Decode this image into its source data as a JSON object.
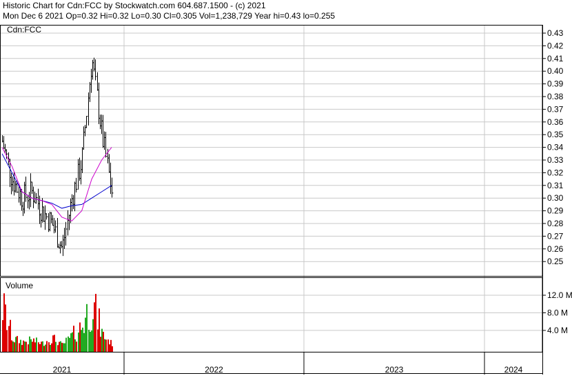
{
  "header": {
    "line1": "Historic Chart for Cdn:FCC by Stockwatch.com 604.687.1500 - (c) 2021",
    "line2": "Mon Dec  6 2021  Op=0.32  Hi=0.32  Lo=0.30  Cl=0.305  Vol=1,238,729  Year hi=0.43  lo=0.255"
  },
  "colors": {
    "background": "#ffffff",
    "grid": "#c8c8c8",
    "frame": "#000000",
    "price_bar": "#000000",
    "ma_short": "#0000cc",
    "ma_long": "#cc00cc",
    "volume_up": "#22aa22",
    "volume_down": "#dd0000"
  },
  "chart_data": [
    {
      "type": "line",
      "subtype": "ohlc-price",
      "symbol_label": "Cdn:FCC",
      "ylim": [
        0.24,
        0.435
      ],
      "y_ticks": [
        "0.25",
        "0.26",
        "0.27",
        "0.28",
        "0.29",
        "0.30",
        "0.31",
        "0.32",
        "0.33",
        "0.34",
        "0.35",
        "0.36",
        "0.37",
        "0.38",
        "0.39",
        "0.40",
        "0.41",
        "0.42",
        "0.43"
      ],
      "x_labels": [
        "2021",
        "2022",
        "2023",
        "2024"
      ],
      "grid": true,
      "x": [
        "2021-01",
        "2021-02",
        "2021-03",
        "2021-04",
        "2021-05",
        "2021-06",
        "2021-07",
        "2021-08",
        "2021-09",
        "2021-10",
        "2021-11",
        "2021-12"
      ],
      "series": [
        {
          "close": [
            0.345,
            0.315,
            0.3,
            0.305,
            0.29,
            0.28,
            0.26,
            0.3,
            0.33,
            0.41,
            0.35,
            0.305
          ]
        },
        {
          "ma": "short",
          "values": [
            0.335,
            0.32,
            0.305,
            0.3,
            0.298,
            0.296,
            0.292,
            0.294,
            0.295,
            0.3,
            0.305,
            0.31
          ]
        },
        {
          "ma": "long",
          "values": [
            0.34,
            0.325,
            0.305,
            0.3,
            0.298,
            0.295,
            0.285,
            0.282,
            0.29,
            0.315,
            0.33,
            0.34
          ]
        }
      ]
    },
    {
      "type": "bar",
      "title": "Volume",
      "ylim": [
        0,
        16
      ],
      "y_ticks": [
        "4.0 M",
        "8.0 M",
        "12.0 M"
      ],
      "x": [
        "2021-01",
        "2021-02",
        "2021-03",
        "2021-04",
        "2021-05",
        "2021-06",
        "2021-07",
        "2021-08",
        "2021-09",
        "2021-10",
        "2021-11",
        "2021-12"
      ],
      "values": [
        13.5,
        3.0,
        2.0,
        2.5,
        1.5,
        3.2,
        1.0,
        4.0,
        7.2,
        15.0,
        4.5,
        1.2
      ]
    }
  ]
}
